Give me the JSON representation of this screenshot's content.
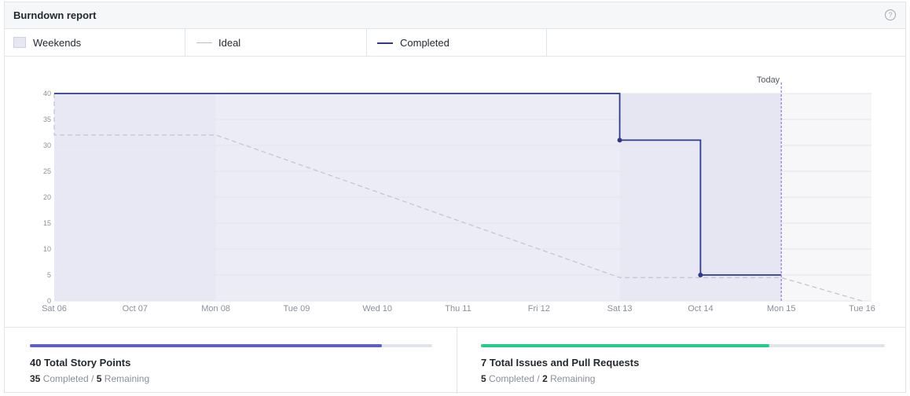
{
  "header": {
    "title": "Burndown report",
    "help_icon": "question-circle-icon"
  },
  "legend": [
    {
      "label": "Weekends",
      "kind": "swatch",
      "color": "#e6e6f4"
    },
    {
      "label": "Ideal",
      "kind": "line",
      "color": "#b8bcc4"
    },
    {
      "label": "Completed",
      "kind": "line",
      "color": "#2d3a8c"
    }
  ],
  "chart_data": {
    "type": "line",
    "x_ticks": [
      "Sat 06",
      "Oct 07",
      "Mon 08",
      "Tue 09",
      "Wed 10",
      "Thu 11",
      "Fri 12",
      "Sat 13",
      "Oct 14",
      "Mon 15",
      "Tue 16"
    ],
    "y_ticks": [
      0,
      5,
      10,
      15,
      20,
      25,
      30,
      35,
      40
    ],
    "ylim": [
      0,
      40
    ],
    "today_label": "Today",
    "today_x": 9,
    "grid": true,
    "weekends": [
      [
        0,
        2
      ],
      [
        7,
        9
      ]
    ],
    "series": [
      {
        "name": "Ideal",
        "style": "dashed",
        "color": "#c4c7cf",
        "points": [
          [
            0,
            40
          ],
          [
            0,
            32
          ],
          [
            2,
            32
          ],
          [
            7,
            4.5
          ],
          [
            9,
            4.5
          ],
          [
            10,
            0
          ]
        ]
      },
      {
        "name": "Completed",
        "style": "step",
        "color": "#2d3a8c",
        "points": [
          [
            0,
            40
          ],
          [
            7,
            40
          ],
          [
            7,
            31
          ],
          [
            8,
            31
          ],
          [
            8,
            5
          ],
          [
            9,
            5
          ]
        ],
        "markers": [
          [
            7,
            31
          ],
          [
            8,
            5
          ]
        ]
      }
    ]
  },
  "stats": [
    {
      "title": "40 Total Story Points",
      "completed": "35",
      "completed_label": "Completed /",
      "remaining": "5",
      "remaining_label": "Remaining",
      "progress": 0.875,
      "color": "#5b5fc7"
    },
    {
      "title": "7 Total Issues and Pull Requests",
      "completed": "5",
      "completed_label": "Completed /",
      "remaining": "2",
      "remaining_label": "Remaining",
      "progress": 0.714,
      "color": "#1fce8c"
    }
  ]
}
